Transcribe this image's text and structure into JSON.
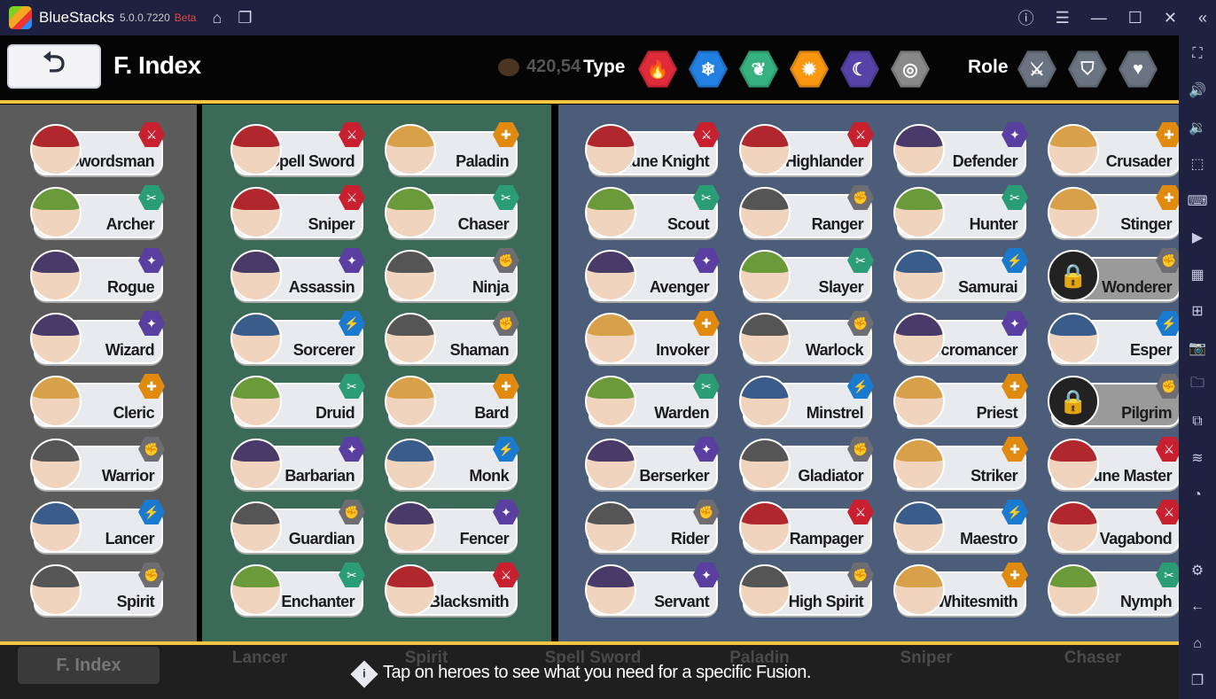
{
  "window": {
    "app_name": "BlueStacks",
    "version": "5.0.0.7220",
    "channel": "Beta"
  },
  "header": {
    "title": "F. Index",
    "gold": "420,54",
    "type_label": "Type",
    "role_label": "Role",
    "types": [
      {
        "icon": "fire-icon",
        "glyph": "🔥",
        "color": "#c32532"
      },
      {
        "icon": "ice-icon",
        "glyph": "❄",
        "color": "#1d6fc4"
      },
      {
        "icon": "leaf-icon",
        "glyph": "❦",
        "color": "#2f9a6e"
      },
      {
        "icon": "sun-icon",
        "glyph": "✹",
        "color": "#d9830f"
      },
      {
        "icon": "moon-icon",
        "glyph": "☾",
        "color": "#4a3a92"
      },
      {
        "icon": "neutral-icon",
        "glyph": "◎",
        "color": "#777777"
      }
    ],
    "roles": [
      {
        "icon": "sword-icon",
        "glyph": "⚔",
        "color": "#5c6470"
      },
      {
        "icon": "shield-icon",
        "glyph": "⛉",
        "color": "#5c6470"
      },
      {
        "icon": "heart-icon",
        "glyph": "♥",
        "color": "#5c6470"
      }
    ]
  },
  "colors": {
    "red": "#c8202f",
    "green": "#2a9d76",
    "purple": "#5a3ea0",
    "blue": "#1a7ad0",
    "orange": "#e08a10",
    "gray": "#6e6e72",
    "panel_gray": "#5b5b5b",
    "panel_green": "#3c6a58",
    "panel_blue": "#4b5d78",
    "gold_line": "#f5c542"
  },
  "columns": [
    {
      "panel": 0,
      "heroes": [
        [
          "Swordsman",
          "red"
        ],
        [
          "Archer",
          "green"
        ],
        [
          "Rogue",
          "purple"
        ],
        [
          "Wizard",
          "purple"
        ],
        [
          "Cleric",
          "orange"
        ],
        [
          "Warrior",
          "gray"
        ],
        [
          "Lancer",
          "blue"
        ],
        [
          "Spirit",
          "gray"
        ]
      ]
    },
    {
      "panel": 1,
      "heroes": [
        [
          "Spell Sword",
          "red"
        ],
        [
          "Sniper",
          "red"
        ],
        [
          "Assassin",
          "purple"
        ],
        [
          "Sorcerer",
          "blue"
        ],
        [
          "Druid",
          "green"
        ],
        [
          "Barbarian",
          "purple"
        ],
        [
          "Guardian",
          "gray"
        ],
        [
          "Enchanter",
          "green"
        ]
      ]
    },
    {
      "panel": 1,
      "heroes": [
        [
          "Paladin",
          "orange"
        ],
        [
          "Chaser",
          "green"
        ],
        [
          "Ninja",
          "gray"
        ],
        [
          "Shaman",
          "gray"
        ],
        [
          "Bard",
          "orange"
        ],
        [
          "Monk",
          "blue"
        ],
        [
          "Fencer",
          "purple"
        ],
        [
          "Blacksmith",
          "red"
        ]
      ]
    },
    {
      "panel": 2,
      "heroes": [
        [
          "Rune Knight",
          "red"
        ],
        [
          "Scout",
          "green"
        ],
        [
          "Avenger",
          "purple"
        ],
        [
          "Invoker",
          "orange"
        ],
        [
          "Warden",
          "green"
        ],
        [
          "Berserker",
          "purple"
        ],
        [
          "Rider",
          "gray"
        ],
        [
          "Servant",
          "purple"
        ]
      ]
    },
    {
      "panel": 2,
      "heroes": [
        [
          "Highlander",
          "red"
        ],
        [
          "Ranger",
          "gray"
        ],
        [
          "Slayer",
          "green"
        ],
        [
          "Warlock",
          "gray"
        ],
        [
          "Minstrel",
          "blue"
        ],
        [
          "Gladiator",
          "gray"
        ],
        [
          "Rampager",
          "red"
        ],
        [
          "High Spirit",
          "gray"
        ]
      ]
    },
    {
      "panel": 2,
      "heroes": [
        [
          "Defender",
          "purple"
        ],
        [
          "Hunter",
          "green"
        ],
        [
          "Samurai",
          "blue"
        ],
        [
          "Necromancer",
          "purple"
        ],
        [
          "Priest",
          "orange"
        ],
        [
          "Striker",
          "orange"
        ],
        [
          "Maestro",
          "blue"
        ],
        [
          "Whitesmith",
          "orange"
        ]
      ]
    },
    {
      "panel": 2,
      "heroes": [
        [
          "Crusader",
          "orange"
        ],
        [
          "Stinger",
          "orange"
        ],
        [
          "Wonderer",
          "gray",
          "locked"
        ],
        [
          "Esper",
          "blue"
        ],
        [
          "Pilgrim",
          "gray",
          "locked"
        ],
        [
          "Rune Master",
          "red"
        ],
        [
          "Vagabond",
          "red"
        ],
        [
          "Nymph",
          "green"
        ]
      ]
    }
  ],
  "bottom": {
    "findex_button": "F. Index",
    "background_labels": [
      "Lancer",
      "Spirit",
      "Spell Sword",
      "Paladin",
      "Sniper",
      "Chaser"
    ],
    "tip": "Tap on heroes to see what you need for a specific Fusion."
  }
}
